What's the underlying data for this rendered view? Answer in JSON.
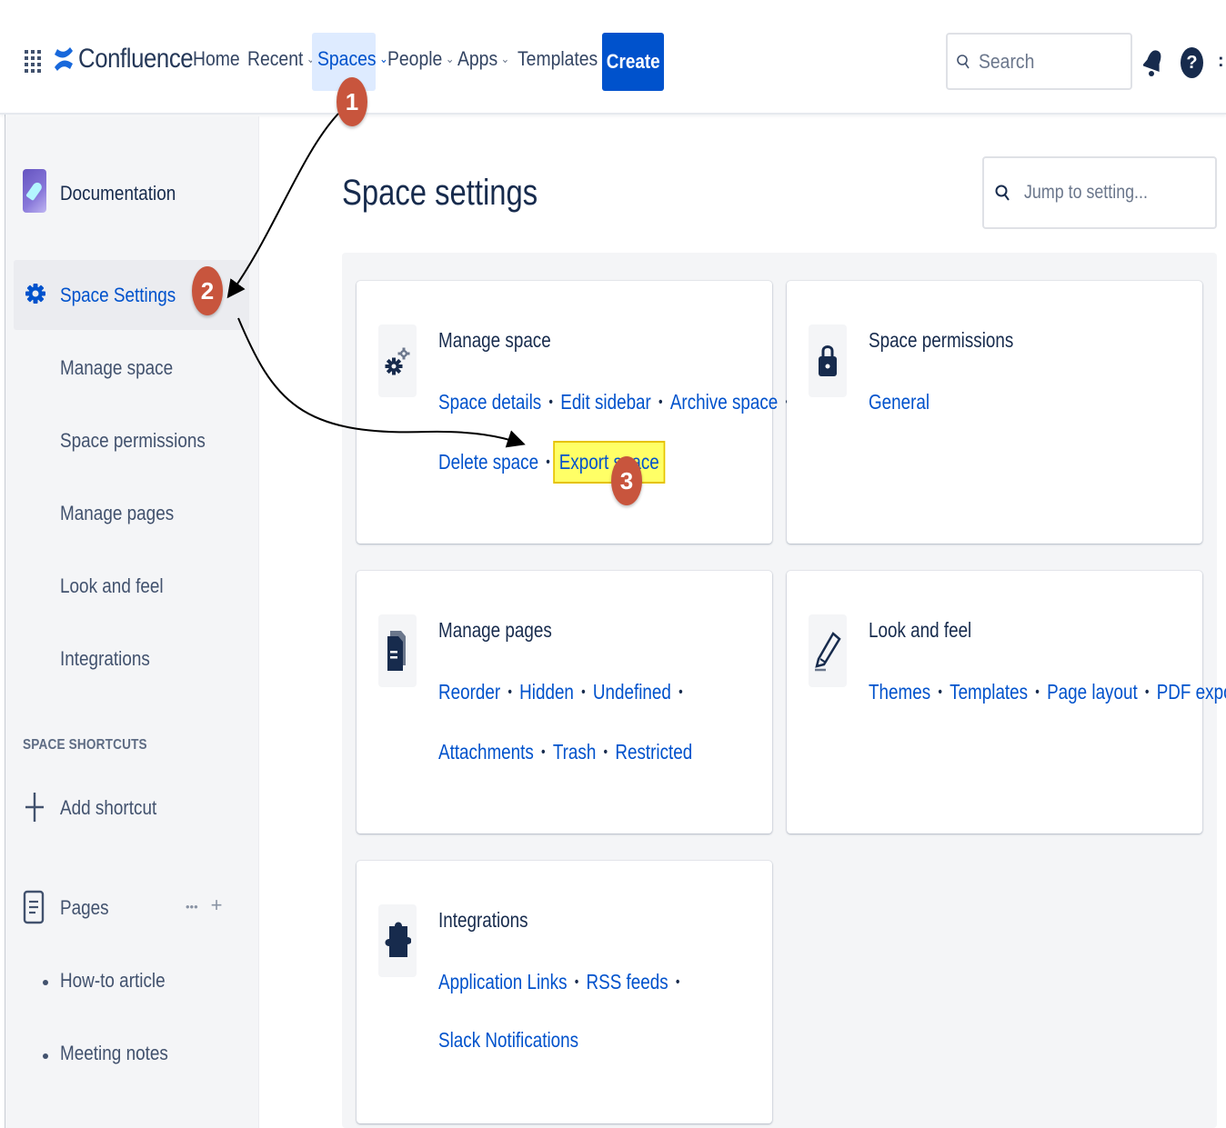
{
  "topnav": {
    "brand": "Confluence",
    "items": [
      {
        "label": "Home",
        "has_menu": false
      },
      {
        "label": "Recent",
        "has_menu": true
      },
      {
        "label": "Spaces",
        "has_menu": true
      },
      {
        "label": "People",
        "has_menu": true
      },
      {
        "label": "Apps",
        "has_menu": true
      },
      {
        "label": "Templates",
        "has_menu": false
      }
    ],
    "create_label": "Create",
    "search_placeholder": "Search",
    "help_glyph": "?",
    "chevron_glyph": "⌄"
  },
  "sidebar": {
    "space_name": "Documentation",
    "selected_item": "Space Settings",
    "sub_items": [
      "Manage space",
      "Space permissions",
      "Manage pages",
      "Look and feel",
      "Integrations"
    ],
    "shortcuts_heading": "SPACE SHORTCUTS",
    "add_shortcut_label": "Add shortcut",
    "pages_label": "Pages",
    "pages_more_glyph": "•••",
    "pages_add_glyph": "+",
    "pages": [
      "How-to article",
      "Meeting notes"
    ]
  },
  "main": {
    "title": "Space settings",
    "jump_placeholder": "Jump to setting...",
    "cards": {
      "manage_space": {
        "title": "Manage space",
        "icon": "gears-icon",
        "row1": [
          "Space details",
          "Edit sidebar",
          "Archive space"
        ],
        "row2": [
          "Delete space",
          "Export space"
        ]
      },
      "permissions": {
        "title": "Space permissions",
        "icon": "lock-icon",
        "row1": [
          "General"
        ]
      },
      "manage_pages": {
        "title": "Manage pages",
        "icon": "document-icon",
        "row1": [
          "Reorder",
          "Hidden",
          "Undefined"
        ],
        "row2": [
          "Attachments",
          "Trash",
          "Restricted"
        ]
      },
      "look_feel": {
        "title": "Look and feel",
        "icon": "pencil-icon",
        "row1": [
          "Themes",
          "Templates",
          "Page layout",
          "PDF export"
        ]
      },
      "integrations": {
        "title": "Integrations",
        "icon": "puzzle-icon",
        "row1": [
          "Application Links",
          "RSS feeds"
        ],
        "row2": [
          "Slack Notifications"
        ]
      }
    },
    "separator": "•"
  },
  "annotations": {
    "steps": [
      "1",
      "2",
      "3"
    ],
    "highlighted_link": "Export space"
  },
  "colors": {
    "brand_blue": "#0052cc",
    "nav_selected_bg": "#deebff",
    "badge": "#c8553d",
    "highlight": "#ffff66"
  }
}
